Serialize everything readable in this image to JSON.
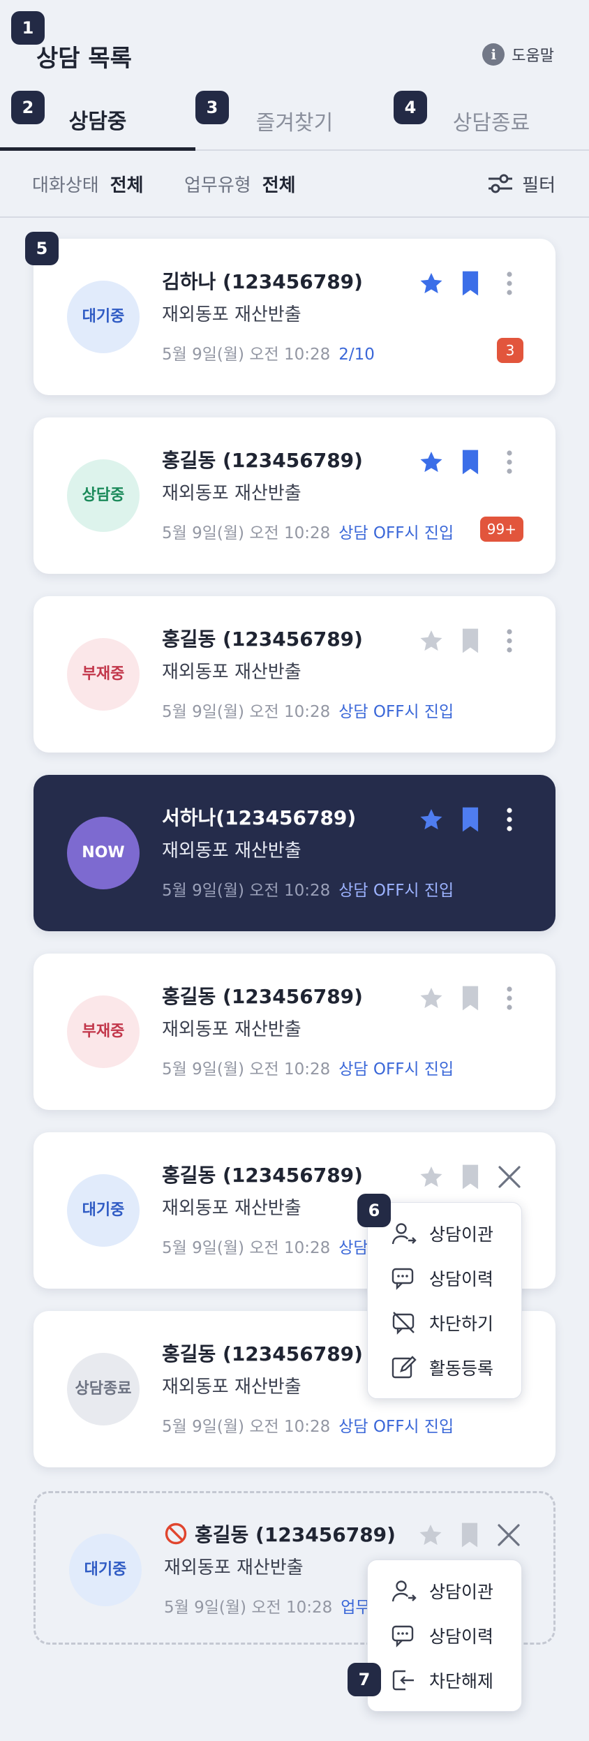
{
  "header": {
    "title": "상담 목록",
    "help_label": "도움말"
  },
  "tabs": [
    {
      "label": "상담중",
      "active": true
    },
    {
      "label": "즐겨찾기",
      "active": false
    },
    {
      "label": "상담종료",
      "active": false
    }
  ],
  "filters": {
    "status_label": "대화상태",
    "status_value": "전체",
    "type_label": "업무유형",
    "type_value": "전체",
    "filter_button": "필터"
  },
  "annotation_numbers": [
    "1",
    "2",
    "3",
    "4",
    "5",
    "6",
    "7"
  ],
  "cards": [
    {
      "status": "대기중",
      "name": "김하나 (123456789)",
      "subject": "재외동포 재산반출",
      "datetime": "5월 9일(월) 오전 10:28",
      "extra": "2/10",
      "unread": "3",
      "star": true,
      "bookmark": true
    },
    {
      "status": "상담중",
      "name": "홍길동 (123456789)",
      "subject": "재외동포 재산반출",
      "datetime": "5월 9일(월) 오전 10:28",
      "extra": "상담 OFF시 진입",
      "unread": "99+",
      "star": true,
      "bookmark": true
    },
    {
      "status": "부재중",
      "name": "홍길동 (123456789)",
      "subject": "재외동포 재산반출",
      "datetime": "5월 9일(월) 오전 10:28",
      "extra": "상담 OFF시 진입",
      "star": false,
      "bookmark": false
    },
    {
      "status": "NOW",
      "name": "서하나(123456789)",
      "subject": "재외동포 재산반출",
      "datetime": "5월 9일(월) 오전 10:28",
      "extra": "상담 OFF시 진입",
      "star": true,
      "bookmark": true
    },
    {
      "status": "부재중",
      "name": "홍길동 (123456789)",
      "subject": "재외동포 재산반출",
      "datetime": "5월 9일(월) 오전 10:28",
      "extra": "상담 OFF시 진입",
      "star": false,
      "bookmark": false
    },
    {
      "status": "대기중",
      "name": "홍길동 (123456789)",
      "subject": "재외동포 재산반출",
      "datetime": "5월 9일(월) 오전 10:28",
      "extra": "상담",
      "star": false,
      "bookmark": false
    },
    {
      "status_line1": "상담",
      "status_line2": "종료",
      "name": "홍길동 (123456789)",
      "subject": "재외동포 재산반출",
      "datetime": "5월 9일(월) 오전 10:28",
      "extra": "상담 OFF시 진입",
      "star": false,
      "bookmark": false
    },
    {
      "status": "대기중",
      "name": "홍길동 (123456789)",
      "subject": "재외동포 재산반출",
      "datetime": "5월 9일(월) 오전 10:28",
      "extra": "업무",
      "star": false,
      "bookmark": false,
      "blocked": true
    }
  ],
  "menu1": {
    "items": [
      "상담이관",
      "상담이력",
      "차단하기",
      "활동등록"
    ]
  },
  "menu2": {
    "items": [
      "상담이관",
      "상담이력",
      "차단해제"
    ]
  },
  "colors": {
    "accent": "#3a67d8",
    "dark_card": "#252c4b",
    "badge": "#232a45",
    "alert": "#e2553c",
    "star_on": "#3b6ee8",
    "star_off": "#c8ccd4"
  }
}
